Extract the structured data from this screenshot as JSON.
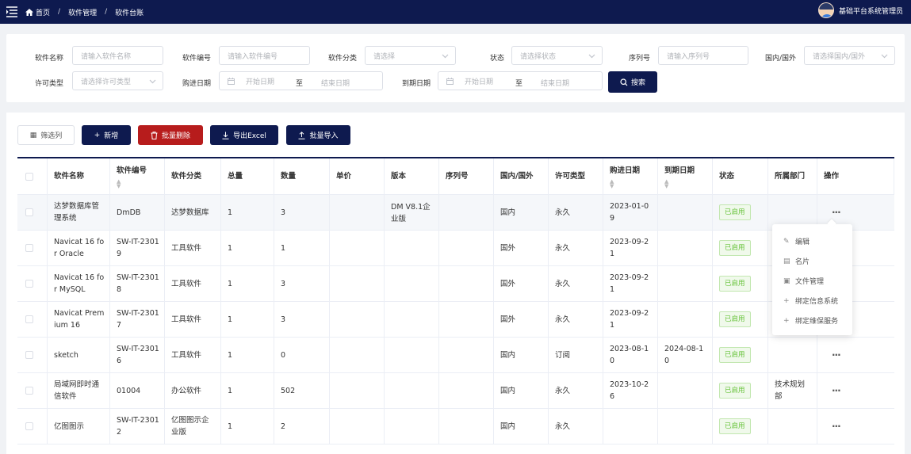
{
  "header": {
    "breadcrumbs": [
      "首页",
      "软件管理",
      "软件台账"
    ],
    "separator": "/",
    "username": "基础平台系统管理员"
  },
  "filters": {
    "software_name": {
      "label": "软件名称",
      "placeholder": "请输入软件名称"
    },
    "software_code": {
      "label": "软件编号",
      "placeholder": "请输入软件编号"
    },
    "category": {
      "label": "软件分类",
      "placeholder": "请选择"
    },
    "status": {
      "label": "状态",
      "placeholder": "请选择状态"
    },
    "serial": {
      "label": "序列号",
      "placeholder": "请输入序列号"
    },
    "domestic": {
      "label": "国内/国外",
      "placeholder": "请选择国内/国外"
    },
    "license": {
      "label": "许可类型",
      "placeholder": "请选择许可类型"
    },
    "purchase_date": {
      "label": "购进日期",
      "start": "开始日期",
      "to": "至",
      "end": "结束日期"
    },
    "expire_date": {
      "label": "到期日期",
      "start": "开始日期",
      "to": "至",
      "end": "结束日期"
    },
    "search_label": "搜索"
  },
  "toolbar": {
    "columns_label": "筛选列",
    "add_label": "新增",
    "batch_delete_label": "批量删除",
    "export_label": "导出Excel",
    "import_label": "批量导入"
  },
  "table": {
    "columns": [
      "软件名称",
      "软件编号",
      "软件分类",
      "总量",
      "数量",
      "单价",
      "版本",
      "序列号",
      "国内/国外",
      "许可类型",
      "购进日期",
      "到期日期",
      "状态",
      "所属部门",
      "操作"
    ],
    "rows": [
      {
        "name": "达梦数据库管理系统",
        "code": "DmDB",
        "category": "达梦数据库",
        "total": "1",
        "qty": "3",
        "price": "",
        "version": "DM V8.1企业版",
        "serial": "",
        "domestic": "国内",
        "license": "永久",
        "purchase": "2023-01-09",
        "expire": "",
        "status": "已启用",
        "dept": ""
      },
      {
        "name": "Navicat 16 for Oracle",
        "code": "SW-IT-23019",
        "category": "工具软件",
        "total": "1",
        "qty": "1",
        "price": "",
        "version": "",
        "serial": "",
        "domestic": "国外",
        "license": "永久",
        "purchase": "2023-09-21",
        "expire": "",
        "status": "已启用",
        "dept": ""
      },
      {
        "name": "Navicat 16 for MySQL",
        "code": "SW-IT-23018",
        "category": "工具软件",
        "total": "1",
        "qty": "3",
        "price": "",
        "version": "",
        "serial": "",
        "domestic": "国外",
        "license": "永久",
        "purchase": "2023-09-21",
        "expire": "",
        "status": "已启用",
        "dept": ""
      },
      {
        "name": "Navicat Premium 16",
        "code": "SW-IT-23017",
        "category": "工具软件",
        "total": "1",
        "qty": "3",
        "price": "",
        "version": "",
        "serial": "",
        "domestic": "国外",
        "license": "永久",
        "purchase": "2023-09-21",
        "expire": "",
        "status": "已启用",
        "dept": ""
      },
      {
        "name": "sketch",
        "code": "SW-IT-23016",
        "category": "工具软件",
        "total": "1",
        "qty": "0",
        "price": "",
        "version": "",
        "serial": "",
        "domestic": "国内",
        "license": "订阅",
        "purchase": "2023-08-10",
        "expire": "2024-08-10",
        "status": "已启用",
        "dept": ""
      },
      {
        "name": "局域网即时通信软件",
        "code": "01004",
        "category": "办公软件",
        "total": "1",
        "qty": "502",
        "price": "",
        "version": "",
        "serial": "",
        "domestic": "国内",
        "license": "永久",
        "purchase": "2023-10-26",
        "expire": "",
        "status": "已启用",
        "dept": "技术规划部"
      },
      {
        "name": "亿图图示",
        "code": "SW-IT-23012",
        "category": "亿图图示企业版",
        "total": "1",
        "qty": "2",
        "price": "",
        "version": "",
        "serial": "",
        "domestic": "国内",
        "license": "永久",
        "purchase": "",
        "expire": "",
        "status": "已启用",
        "dept": ""
      }
    ],
    "more_label": "···"
  },
  "dropdown": {
    "items": [
      "编辑",
      "名片",
      "文件管理",
      "绑定信息系统",
      "绑定维保服务"
    ]
  },
  "colors": {
    "primary": "#0e1a4f",
    "danger": "#b71c1c",
    "success": "#67c23a"
  }
}
